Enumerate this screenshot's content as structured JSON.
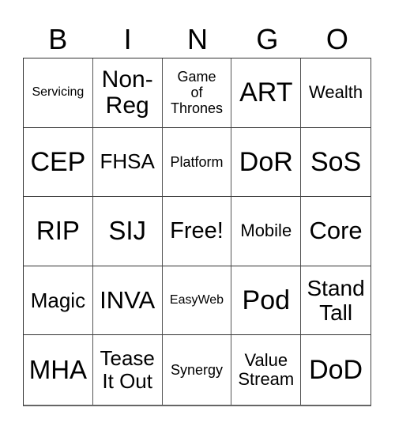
{
  "header": [
    "B",
    "I",
    "N",
    "G",
    "O"
  ],
  "cells": [
    {
      "text": "Servicing",
      "size": "sm"
    },
    {
      "text": "Non-\nReg",
      "size": "xl"
    },
    {
      "text": "Game\nof\nThrones",
      "size": "md"
    },
    {
      "text": "ART",
      "size": "xxl"
    },
    {
      "text": "Wealth",
      "size": "lg"
    },
    {
      "text": "CEP",
      "size": "xxl"
    },
    {
      "text": "FHSA",
      "size": "xl"
    },
    {
      "text": "Platform",
      "size": "md"
    },
    {
      "text": "DoR",
      "size": "xxl"
    },
    {
      "text": "SoS",
      "size": "xxl"
    },
    {
      "text": "RIP",
      "size": "xxl"
    },
    {
      "text": "SIJ",
      "size": "xxl"
    },
    {
      "text": "Free!",
      "size": "xl"
    },
    {
      "text": "Mobile",
      "size": "lg"
    },
    {
      "text": "Core",
      "size": "xxl"
    },
    {
      "text": "Magic",
      "size": "xl"
    },
    {
      "text": "INVA",
      "size": "xxl"
    },
    {
      "text": "EasyWeb",
      "size": "sm"
    },
    {
      "text": "Pod",
      "size": "xxl"
    },
    {
      "text": "Stand\nTall",
      "size": "xl"
    },
    {
      "text": "MHA",
      "size": "xxl"
    },
    {
      "text": "Tease\nIt Out",
      "size": "xl"
    },
    {
      "text": "Synergy",
      "size": "md"
    },
    {
      "text": "Value\nStream",
      "size": "lg"
    },
    {
      "text": "DoD",
      "size": "xxl"
    }
  ]
}
